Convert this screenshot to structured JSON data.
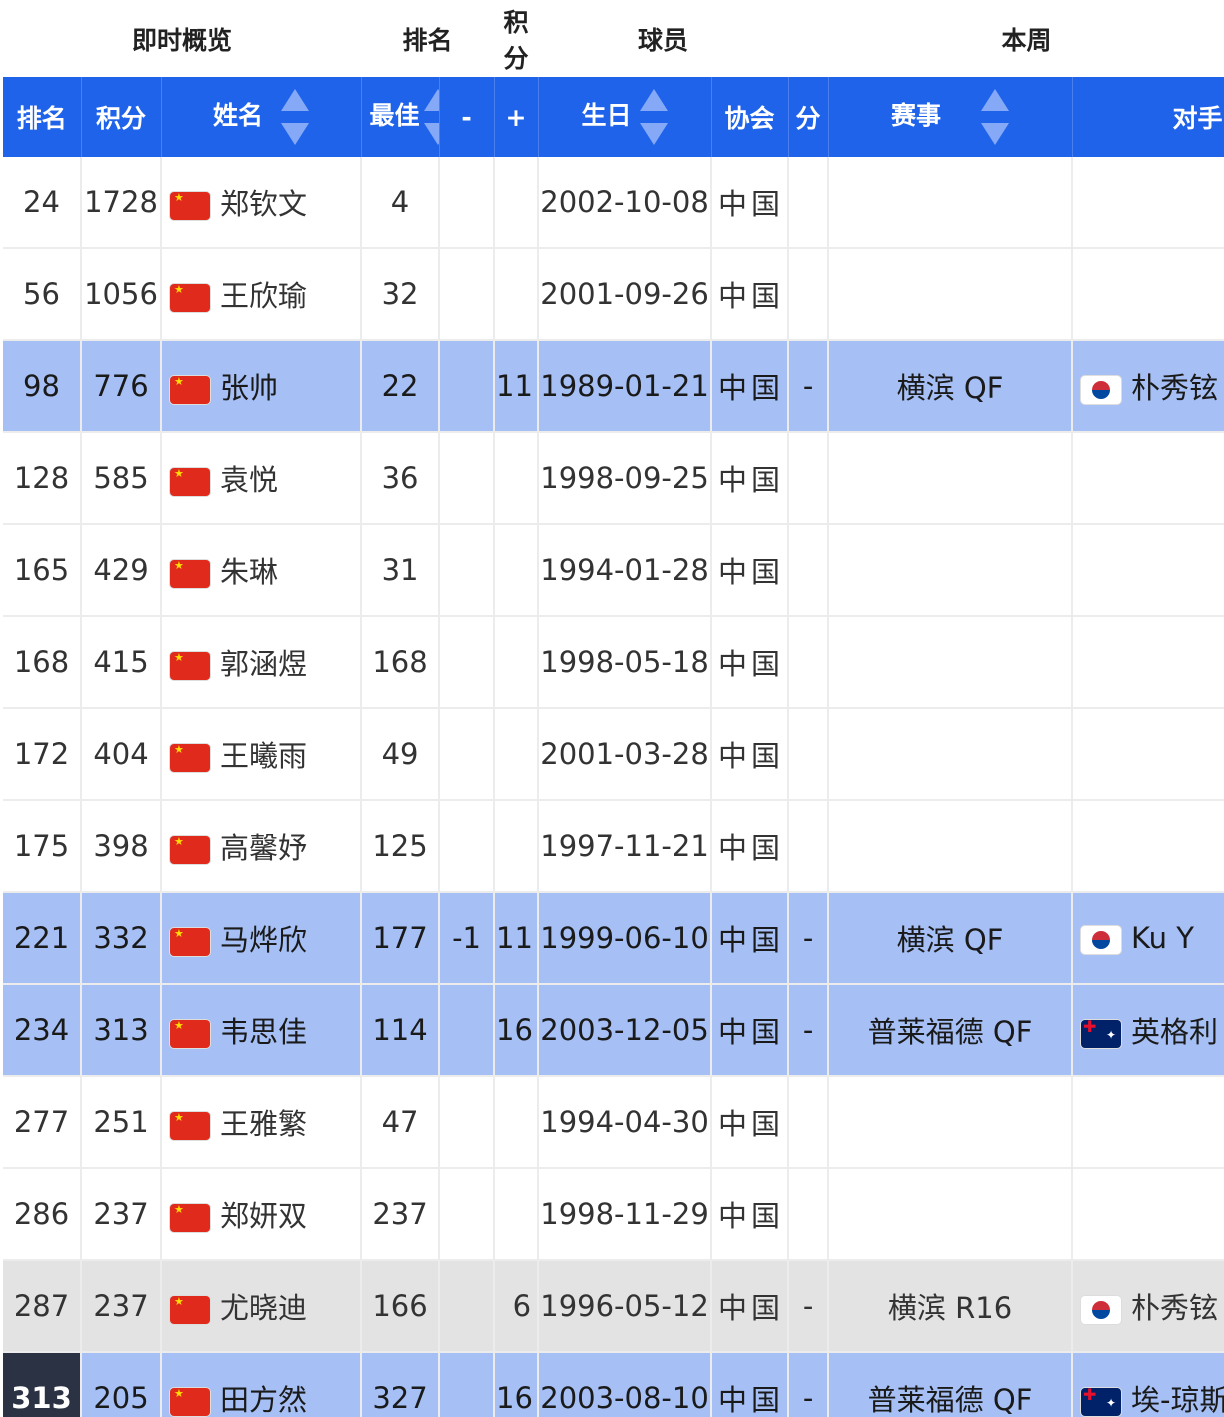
{
  "super_headers": {
    "overview": "即时概览",
    "rank": "排名",
    "points": "积分",
    "player": "球员",
    "this_week": "本周"
  },
  "columns": {
    "rank": "排名",
    "points": "积分",
    "name": "姓名",
    "best": "最佳",
    "minus": "-",
    "plus": "+",
    "birthday": "生日",
    "association": "协会",
    "diff": "分",
    "event": "赛事",
    "opponent": "对手"
  },
  "rows": [
    {
      "rank": "24",
      "points": "1728",
      "flag": "cn",
      "name": "郑钦文",
      "best": "4",
      "minus": "",
      "plus": "",
      "birthday": "2002-10-08",
      "association": "中国",
      "diff": "",
      "event": "",
      "opp_flag": "",
      "opponent": "",
      "style": ""
    },
    {
      "rank": "56",
      "points": "1056",
      "flag": "cn",
      "name": "王欣瑜",
      "best": "32",
      "minus": "",
      "plus": "",
      "birthday": "2001-09-26",
      "association": "中国",
      "diff": "",
      "event": "",
      "opp_flag": "",
      "opponent": "",
      "style": ""
    },
    {
      "rank": "98",
      "points": "776",
      "flag": "cn",
      "name": "张帅",
      "best": "22",
      "minus": "",
      "plus": "11",
      "birthday": "1989-01-21",
      "association": "中国",
      "diff": "-",
      "event": "横滨 QF",
      "opp_flag": "kr",
      "opponent": "朴秀铉",
      "style": "hl"
    },
    {
      "rank": "128",
      "points": "585",
      "flag": "cn",
      "name": "袁悦",
      "best": "36",
      "minus": "",
      "plus": "",
      "birthday": "1998-09-25",
      "association": "中国",
      "diff": "",
      "event": "",
      "opp_flag": "",
      "opponent": "",
      "style": ""
    },
    {
      "rank": "165",
      "points": "429",
      "flag": "cn",
      "name": "朱琳",
      "best": "31",
      "minus": "",
      "plus": "",
      "birthday": "1994-01-28",
      "association": "中国",
      "diff": "",
      "event": "",
      "opp_flag": "",
      "opponent": "",
      "style": ""
    },
    {
      "rank": "168",
      "points": "415",
      "flag": "cn",
      "name": "郭涵煜",
      "best": "168",
      "minus": "",
      "plus": "",
      "birthday": "1998-05-18",
      "association": "中国",
      "diff": "",
      "event": "",
      "opp_flag": "",
      "opponent": "",
      "style": ""
    },
    {
      "rank": "172",
      "points": "404",
      "flag": "cn",
      "name": "王曦雨",
      "best": "49",
      "minus": "",
      "plus": "",
      "birthday": "2001-03-28",
      "association": "中国",
      "diff": "",
      "event": "",
      "opp_flag": "",
      "opponent": "",
      "style": ""
    },
    {
      "rank": "175",
      "points": "398",
      "flag": "cn",
      "name": "高馨妤",
      "best": "125",
      "minus": "",
      "plus": "",
      "birthday": "1997-11-21",
      "association": "中国",
      "diff": "",
      "event": "",
      "opp_flag": "",
      "opponent": "",
      "style": ""
    },
    {
      "rank": "221",
      "points": "332",
      "flag": "cn",
      "name": "马烨欣",
      "best": "177",
      "minus": "-1",
      "plus": "11",
      "birthday": "1999-06-10",
      "association": "中国",
      "diff": "-",
      "event": "横滨 QF",
      "opp_flag": "kr",
      "opponent": "Ku Y",
      "style": "hl"
    },
    {
      "rank": "234",
      "points": "313",
      "flag": "cn",
      "name": "韦思佳",
      "best": "114",
      "minus": "",
      "plus": "16",
      "birthday": "2003-12-05",
      "association": "中国",
      "diff": "-",
      "event": "普莱福德 QF",
      "opp_flag": "au",
      "opponent": "英格利",
      "style": "hl"
    },
    {
      "rank": "277",
      "points": "251",
      "flag": "cn",
      "name": "王雅繁",
      "best": "47",
      "minus": "",
      "plus": "",
      "birthday": "1994-04-30",
      "association": "中国",
      "diff": "",
      "event": "",
      "opp_flag": "",
      "opponent": "",
      "style": ""
    },
    {
      "rank": "286",
      "points": "237",
      "flag": "cn",
      "name": "郑妍双",
      "best": "237",
      "minus": "",
      "plus": "",
      "birthday": "1998-11-29",
      "association": "中国",
      "diff": "",
      "event": "",
      "opp_flag": "",
      "opponent": "",
      "style": ""
    },
    {
      "rank": "287",
      "points": "237",
      "flag": "cn",
      "name": "尤晓迪",
      "best": "166",
      "minus": "",
      "plus": "6",
      "birthday": "1996-05-12",
      "association": "中国",
      "diff": "-",
      "event": "横滨 R16",
      "opp_flag": "kr",
      "opponent": "朴秀铉",
      "style": "gray"
    },
    {
      "rank": "313",
      "points": "205",
      "flag": "cn",
      "name": "田方然",
      "best": "327",
      "minus": "",
      "plus": "16",
      "birthday": "2003-08-10",
      "association": "中国",
      "diff": "-",
      "event": "普莱福德 QF",
      "opp_flag": "au",
      "opponent": "埃-琼斯",
      "style": "hl self"
    }
  ]
}
